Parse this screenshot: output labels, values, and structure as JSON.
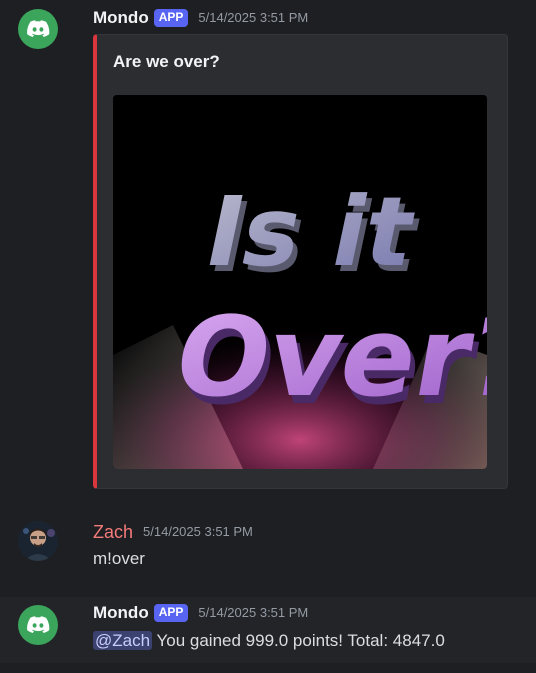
{
  "messages": [
    {
      "author": "Mondo",
      "badge": "APP",
      "timestamp": "5/14/2025 3:51 PM",
      "embed": {
        "title": "Are we over?",
        "image_lines": [
          "Is it",
          "Over?"
        ]
      }
    },
    {
      "author": "Zach",
      "timestamp": "5/14/2025 3:51 PM",
      "content": "m!over"
    },
    {
      "author": "Mondo",
      "badge": "APP",
      "timestamp": "5/14/2025 3:51 PM",
      "mention": "@Zach",
      "content": " You gained 999.0 points! Total: 4847.0"
    }
  ],
  "colors": {
    "background": "#1e1f22",
    "bot_avatar": "#3ba55c",
    "app_badge": "#5865f2",
    "embed_accent": "#da373c",
    "zach_name": "#f47b7b"
  },
  "icons": {
    "bot_avatar": "discord-logo-icon",
    "user_avatar": "user-photo-avatar"
  }
}
